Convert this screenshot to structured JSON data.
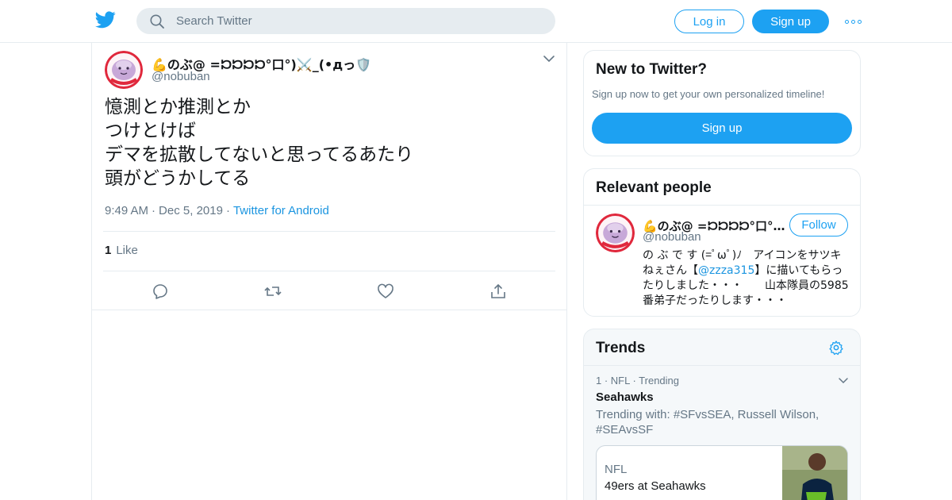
{
  "header": {
    "search_placeholder": "Search Twitter",
    "login_label": "Log in",
    "signup_label": "Sign up",
    "brand_color": "#1da1f2"
  },
  "tweet": {
    "display_name": "💪のぶ@ =𝈀𝈀𝈀𝈀°口°)⚔️_(•дっ🛡️",
    "handle": "@nobuban",
    "text_lines": [
      "憶測とか推測とか",
      "つけとけば",
      "デマを拡散してないと思ってるあたり",
      "頭がどうかしてる"
    ],
    "time": "9:49 AM",
    "date": "Dec 5, 2019",
    "source": "Twitter for Android",
    "like_count": "1",
    "like_label": "Like",
    "actions": [
      "reply-icon",
      "retweet-icon",
      "like-icon",
      "share-icon"
    ]
  },
  "sidebar": {
    "new_to_twitter": {
      "title": "New to Twitter?",
      "subtitle": "Sign up now to get your own personalized timeline!",
      "signup_label": "Sign up"
    },
    "relevant_people": {
      "title": "Relevant people",
      "display_name": "💪のぶ@ =𝈀𝈀𝈀𝈀°口°)...",
      "handle": "@nobuban",
      "follow_label": "Follow",
      "bio_before": "の ぶ で す (=ﾟωﾟ)ﾉ　アイコンをサツキねぇさん【",
      "bio_mention": "@zzza315",
      "bio_after": "】に描いてもらったりしました・・・　　山本隊員の5985番弟子だったりします・・・"
    },
    "trends": {
      "title": "Trends",
      "items": [
        {
          "meta": "1 · NFL · Trending",
          "name": "Seahawks",
          "trending_with": "Trending with: #SFvsSEA, Russell Wilson, #SEAvsSF"
        }
      ],
      "news": {
        "source": "NFL",
        "title": "49ers at Seahawks"
      }
    }
  }
}
